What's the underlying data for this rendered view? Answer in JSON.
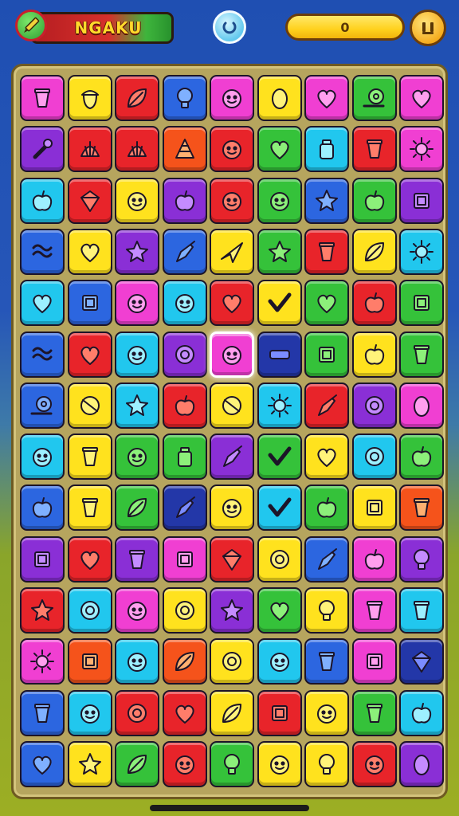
{
  "hud": {
    "title": "NGAKU",
    "score": "0",
    "pencil_icon": "pencil-icon",
    "refresh_icon": "refresh-icon",
    "menu_icon": "menu-icon"
  },
  "colors": {
    "pink": "#f03fd2",
    "yellow": "#ffe21e",
    "red": "#e8242a",
    "blue": "#2c66e0",
    "purple": "#8a2fd6",
    "green": "#35c23a",
    "cyan": "#21c7ee",
    "orange": "#f5531b",
    "navy": "#2337a8",
    "board": "#b6a55e"
  },
  "board": {
    "columns": 9,
    "rows": 14,
    "selected_tile": "5,4",
    "rows_data": [
      [
        [
          "pink",
          "cup"
        ],
        [
          "yellow",
          "acorn"
        ],
        [
          "red",
          "leaf"
        ],
        [
          "blue",
          "bulb"
        ],
        [
          "pink",
          "face"
        ],
        [
          "yellow",
          "egg"
        ],
        [
          "pink",
          "heart"
        ],
        [
          "green",
          "snail"
        ],
        [
          "pink",
          "heart"
        ]
      ],
      [
        [
          "purple",
          "wrench"
        ],
        [
          "red",
          "shell"
        ],
        [
          "red",
          "shell"
        ],
        [
          "orange",
          "wedge"
        ],
        [
          "red",
          "face"
        ],
        [
          "green",
          "heart"
        ],
        [
          "cyan",
          "jar"
        ],
        [
          "red",
          "cup"
        ],
        [
          "pink",
          "sun"
        ]
      ],
      [
        [
          "cyan",
          "apple"
        ],
        [
          "red",
          "gem"
        ],
        [
          "yellow",
          "face"
        ],
        [
          "purple",
          "apple"
        ],
        [
          "red",
          "face"
        ],
        [
          "green",
          "face"
        ],
        [
          "blue",
          "star"
        ],
        [
          "green",
          "apple"
        ],
        [
          "purple",
          "box"
        ]
      ],
      [
        [
          "blue",
          "wave"
        ],
        [
          "yellow",
          "heart"
        ],
        [
          "purple",
          "star"
        ],
        [
          "blue",
          "carrot"
        ],
        [
          "yellow",
          "plane"
        ],
        [
          "green",
          "star"
        ],
        [
          "red",
          "cup"
        ],
        [
          "yellow",
          "leaf"
        ],
        [
          "cyan",
          "sun"
        ]
      ],
      [
        [
          "cyan",
          "heart"
        ],
        [
          "blue",
          "box"
        ],
        [
          "pink",
          "face"
        ],
        [
          "cyan",
          "face"
        ],
        [
          "red",
          "heart"
        ],
        [
          "yellow",
          "check"
        ],
        [
          "green",
          "heart"
        ],
        [
          "red",
          "apple"
        ],
        [
          "green",
          "box"
        ]
      ],
      [
        [
          "blue",
          "wave"
        ],
        [
          "red",
          "heart"
        ],
        [
          "cyan",
          "face"
        ],
        [
          "purple",
          "ring"
        ],
        [
          "pink",
          "face"
        ],
        [
          "navy",
          "bar"
        ],
        [
          "green",
          "box"
        ],
        [
          "yellow",
          "apple"
        ],
        [
          "green",
          "cup"
        ]
      ],
      [
        [
          "blue",
          "snail"
        ],
        [
          "yellow",
          "ball"
        ],
        [
          "cyan",
          "star"
        ],
        [
          "red",
          "apple"
        ],
        [
          "yellow",
          "ball"
        ],
        [
          "cyan",
          "sun"
        ],
        [
          "red",
          "carrot"
        ],
        [
          "purple",
          "ring"
        ],
        [
          "pink",
          "egg"
        ]
      ],
      [
        [
          "cyan",
          "face"
        ],
        [
          "yellow",
          "cup"
        ],
        [
          "green",
          "face"
        ],
        [
          "green",
          "jar"
        ],
        [
          "purple",
          "carrot"
        ],
        [
          "green",
          "check"
        ],
        [
          "yellow",
          "heart"
        ],
        [
          "cyan",
          "ring"
        ],
        [
          "green",
          "apple"
        ]
      ],
      [
        [
          "blue",
          "apple"
        ],
        [
          "yellow",
          "cup"
        ],
        [
          "green",
          "leaf"
        ],
        [
          "navy",
          "carrot"
        ],
        [
          "yellow",
          "face"
        ],
        [
          "cyan",
          "check"
        ],
        [
          "green",
          "apple"
        ],
        [
          "yellow",
          "box"
        ],
        [
          "orange",
          "cup"
        ]
      ],
      [
        [
          "purple",
          "box"
        ],
        [
          "red",
          "heart"
        ],
        [
          "purple",
          "cup"
        ],
        [
          "pink",
          "box"
        ],
        [
          "red",
          "gem"
        ],
        [
          "yellow",
          "ring"
        ],
        [
          "blue",
          "carrot"
        ],
        [
          "pink",
          "apple"
        ],
        [
          "purple",
          "bulb"
        ]
      ],
      [
        [
          "red",
          "star"
        ],
        [
          "cyan",
          "ring"
        ],
        [
          "pink",
          "face"
        ],
        [
          "yellow",
          "ring"
        ],
        [
          "purple",
          "star"
        ],
        [
          "green",
          "heart"
        ],
        [
          "yellow",
          "bulb"
        ],
        [
          "pink",
          "cup"
        ],
        [
          "cyan",
          "cup"
        ]
      ],
      [
        [
          "pink",
          "sun"
        ],
        [
          "orange",
          "box"
        ],
        [
          "cyan",
          "face"
        ],
        [
          "orange",
          "leaf"
        ],
        [
          "yellow",
          "ring"
        ],
        [
          "cyan",
          "face"
        ],
        [
          "blue",
          "cup"
        ],
        [
          "pink",
          "box"
        ],
        [
          "navy",
          "gem"
        ]
      ],
      [
        [
          "blue",
          "cup"
        ],
        [
          "cyan",
          "face"
        ],
        [
          "red",
          "ring"
        ],
        [
          "red",
          "heart"
        ],
        [
          "yellow",
          "leaf"
        ],
        [
          "red",
          "box"
        ],
        [
          "yellow",
          "face"
        ],
        [
          "green",
          "cup"
        ],
        [
          "cyan",
          "apple"
        ]
      ],
      [
        [
          "blue",
          "heart"
        ],
        [
          "yellow",
          "star"
        ],
        [
          "green",
          "leaf"
        ],
        [
          "red",
          "face"
        ],
        [
          "green",
          "bulb"
        ],
        [
          "yellow",
          "face"
        ],
        [
          "yellow",
          "bulb"
        ],
        [
          "red",
          "face"
        ],
        [
          "purple",
          "egg"
        ]
      ]
    ]
  }
}
